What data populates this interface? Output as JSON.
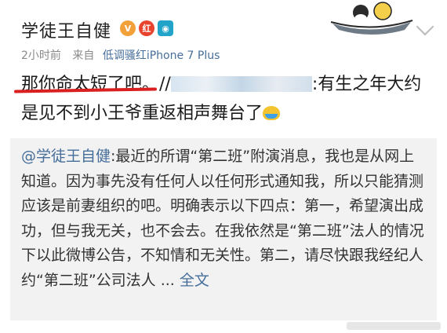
{
  "post": {
    "username": "学徒王自健",
    "badges": [
      "vip-badge-icon",
      "red-badge-icon",
      "camera-badge-icon"
    ],
    "time": "2小时前",
    "from_label": "来自",
    "device": "低调骚红iPhone 7 Plus",
    "text_highlight": "那你命太短了吧。",
    "text_sep": "//",
    "text_rest": ":有生之年大约是见不到小王爷重返相声舞台了"
  },
  "repost": {
    "mention": "@学徒王自健",
    "text": ":最近的所谓“第二班”附演消息，我也是从网上知道。因为事先没有任何人以任何形式通知我，所以只能猜测应该是前妻组织的吧。明确表示以下四点：第一，希望演出成功，但与我无关，也不会去。在我依然是“第二班”法人的情况下以此微博公告，不知情和无关性。第二，请尽快跟我经纪人约“第二班”公司法人 ... ",
    "more": "全文"
  },
  "colors": {
    "link": "#466e9a",
    "underline": "#d91f1f",
    "repost_bg": "#f2f2f2"
  }
}
